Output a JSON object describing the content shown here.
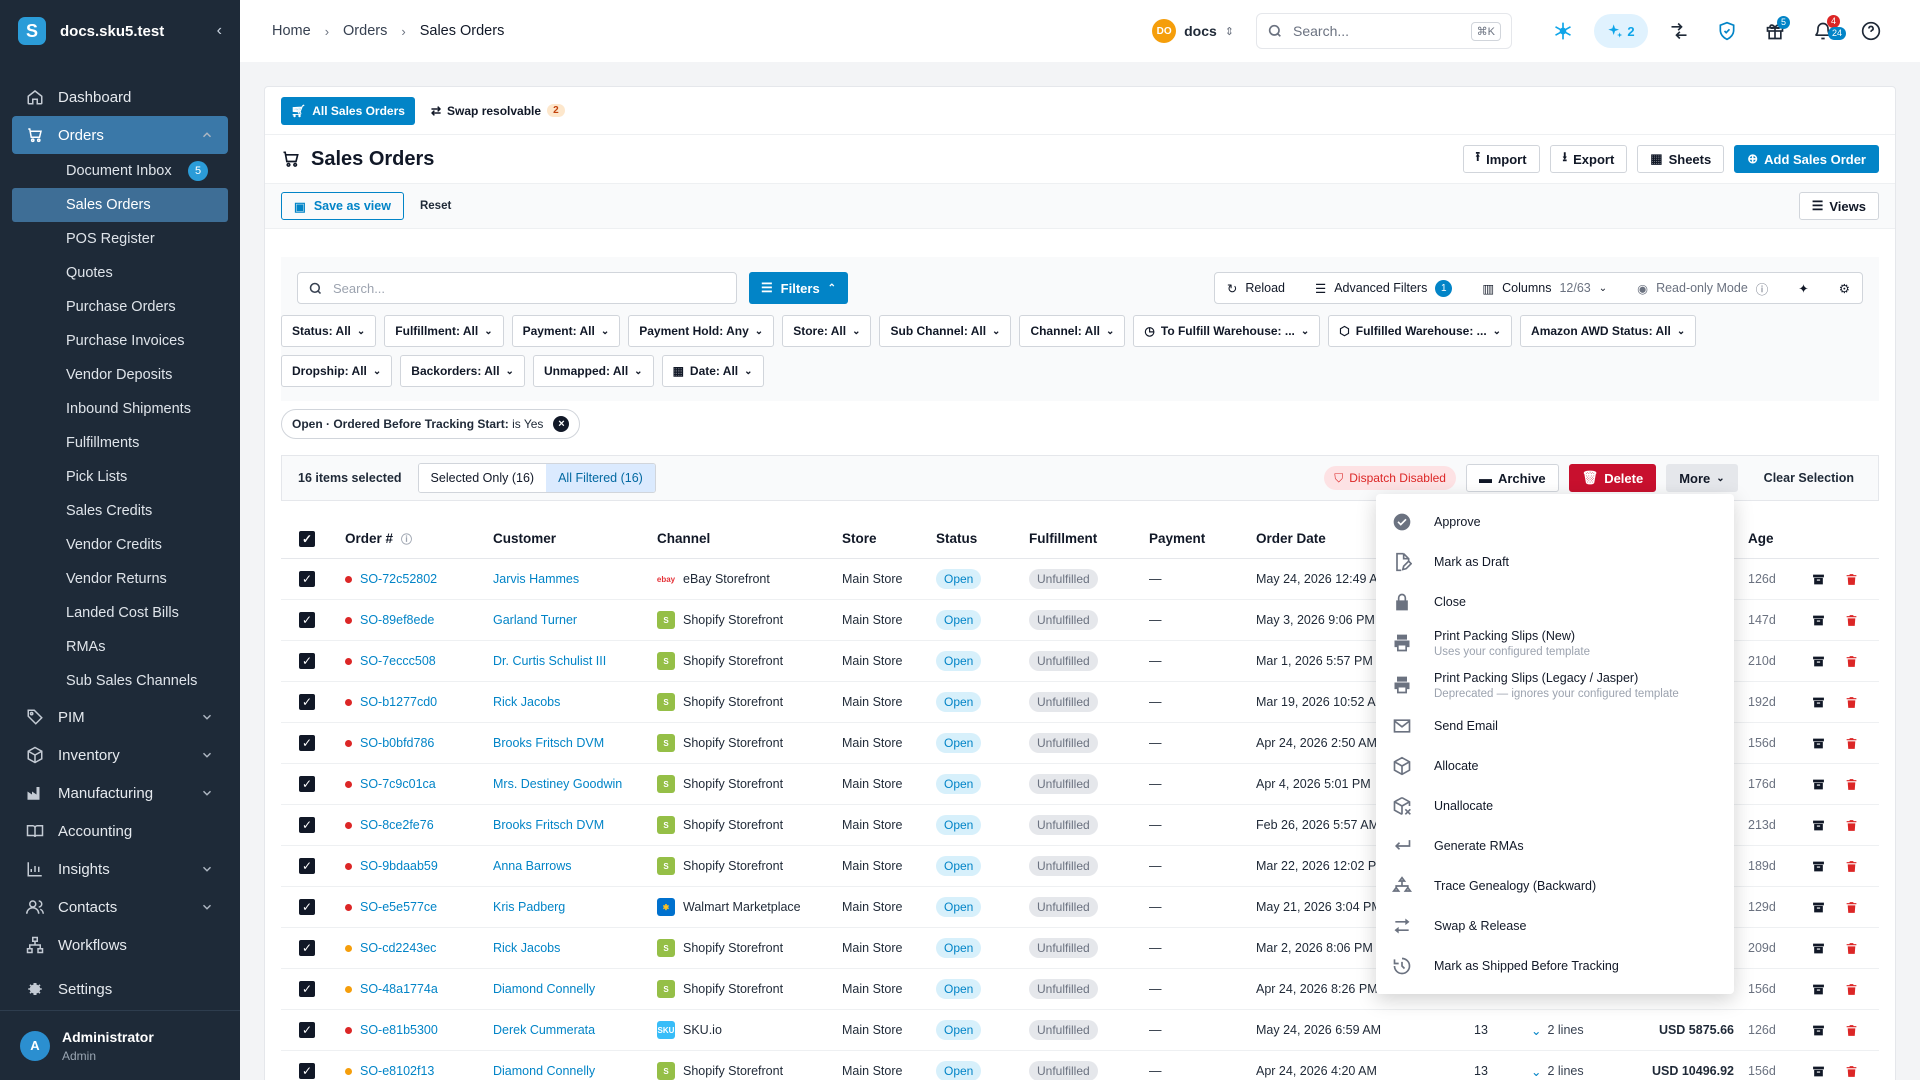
{
  "app": {
    "workspace": "docs.sku5.test",
    "logo_letter": "S"
  },
  "sidebar": {
    "items": [
      {
        "label": "Dashboard",
        "icon": "home-icon"
      },
      {
        "label": "Orders",
        "icon": "cart-icon",
        "active": true
      },
      {
        "label": "PIM",
        "icon": "tag-icon"
      },
      {
        "label": "Inventory",
        "icon": "box-icon"
      },
      {
        "label": "Manufacturing",
        "icon": "factory-icon"
      },
      {
        "label": "Accounting",
        "icon": "book-icon"
      },
      {
        "label": "Insights",
        "icon": "chart-icon"
      },
      {
        "label": "Contacts",
        "icon": "users-icon"
      },
      {
        "label": "Workflows",
        "icon": "workflow-icon"
      },
      {
        "label": "Settings",
        "icon": "gear-icon"
      }
    ],
    "order_sub": [
      "Document Inbox",
      "Sales Orders",
      "POS Register",
      "Quotes",
      "Purchase Orders",
      "Purchase Invoices",
      "Vendor Deposits",
      "Inbound Shipments",
      "Fulfillments",
      "Pick Lists",
      "Sales Credits",
      "Vendor Credits",
      "Vendor Returns",
      "Landed Cost Bills",
      "RMAs",
      "Sub Sales Channels"
    ],
    "inbox_badge": "5",
    "user": {
      "initial": "A",
      "name": "Administrator",
      "role": "Admin"
    }
  },
  "topbar": {
    "crumbs": [
      "Home",
      "Orders",
      "Sales Orders"
    ],
    "workspace_initials": "DO",
    "workspace_name": "docs",
    "search_placeholder": "Search...",
    "search_kbd": "⌘K",
    "ai_count": "2",
    "gift_badge": "5",
    "bell_badge_a": "4",
    "bell_badge_b": "24"
  },
  "tabs": {
    "all": "All Sales Orders",
    "swap": "Swap resolvable",
    "swap_count": "2"
  },
  "header": {
    "title": "Sales Orders",
    "import": "Import",
    "export": "Export",
    "sheets": "Sheets",
    "add": "Add Sales Order"
  },
  "views": {
    "save": "Save as view",
    "reset": "Reset",
    "views": "Views"
  },
  "toolbar": {
    "search_placeholder": "Search...",
    "filters": "Filters",
    "reload": "Reload",
    "advanced": "Advanced Filters",
    "advanced_count": "1",
    "columns": "Columns",
    "columns_count": "12/63",
    "readonly": "Read-only Mode"
  },
  "filter_chips": [
    [
      "Status: All",
      "Fulfillment: All",
      "Payment: All",
      "Payment Hold: Any",
      "Store: All",
      "Sub Channel: All",
      "Channel: All",
      "To Fulfill Warehouse: ...",
      "Fulfilled Warehouse: ...",
      "Amazon AWD Status: All"
    ],
    [
      "Dropship: All",
      "Backorders: All",
      "Unmapped: All",
      "Date: All"
    ]
  ],
  "active_filter": {
    "prefix": "Open · Ordered Before Tracking Start:",
    "value": "is Yes"
  },
  "selection": {
    "count": "16 items selected",
    "selected_only": "Selected Only (16)",
    "all_filtered": "All Filtered (16)",
    "dispatch": "Dispatch Disabled",
    "archive": "Archive",
    "delete": "Delete",
    "more": "More",
    "clear": "Clear Selection"
  },
  "columns": {
    "order": "Order #",
    "customer": "Customer",
    "channel": "Channel",
    "store": "Store",
    "status": "Status",
    "fulfillment": "Fulfillment",
    "payment": "Payment",
    "date": "Order Date",
    "age": "Age"
  },
  "rows": [
    {
      "order": "SO-72c52802",
      "dot": "#dc2626",
      "customer": "Jarvis Hammes",
      "channel": "eBay Storefront",
      "ch": "ebay",
      "store": "Main Store",
      "status": "Open",
      "ful": "Unfulfilled",
      "pay": "—",
      "date": "May 24, 2026 12:49 AM",
      "x1": "",
      "x2": "",
      "amt": "",
      "age": "126d"
    },
    {
      "order": "SO-89ef8ede",
      "dot": "#dc2626",
      "customer": "Garland Turner",
      "channel": "Shopify Storefront",
      "ch": "shopify",
      "store": "Main Store",
      "status": "Open",
      "ful": "Unfulfilled",
      "pay": "—",
      "date": "May 3, 2026 9:06 PM",
      "x1": "",
      "x2": "",
      "amt": "",
      "age": "147d"
    },
    {
      "order": "SO-7eccc508",
      "dot": "#dc2626",
      "customer": "Dr. Curtis Schulist III",
      "channel": "Shopify Storefront",
      "ch": "shopify",
      "store": "Main Store",
      "status": "Open",
      "ful": "Unfulfilled",
      "pay": "—",
      "date": "Mar 1, 2026 5:57 PM",
      "x1": "",
      "x2": "",
      "amt": "",
      "age": "210d"
    },
    {
      "order": "SO-b1277cd0",
      "dot": "#dc2626",
      "customer": "Rick Jacobs",
      "channel": "Shopify Storefront",
      "ch": "shopify",
      "store": "Main Store",
      "status": "Open",
      "ful": "Unfulfilled",
      "pay": "—",
      "date": "Mar 19, 2026 10:52 AM",
      "x1": "",
      "x2": "",
      "amt": "",
      "age": "192d"
    },
    {
      "order": "SO-b0bfd786",
      "dot": "#dc2626",
      "customer": "Brooks Fritsch DVM",
      "channel": "Shopify Storefront",
      "ch": "shopify",
      "store": "Main Store",
      "status": "Open",
      "ful": "Unfulfilled",
      "pay": "—",
      "date": "Apr 24, 2026 2:50 AM",
      "x1": "",
      "x2": "",
      "amt": "",
      "age": "156d"
    },
    {
      "order": "SO-7c9c01ca",
      "dot": "#dc2626",
      "customer": "Mrs. Destiney Goodwin",
      "channel": "Shopify Storefront",
      "ch": "shopify",
      "store": "Main Store",
      "status": "Open",
      "ful": "Unfulfilled",
      "pay": "—",
      "date": "Apr 4, 2026 5:01 PM",
      "x1": "",
      "x2": "",
      "amt": "",
      "age": "176d"
    },
    {
      "order": "SO-8ce2fe76",
      "dot": "#dc2626",
      "customer": "Brooks Fritsch DVM",
      "channel": "Shopify Storefront",
      "ch": "shopify",
      "store": "Main Store",
      "status": "Open",
      "ful": "Unfulfilled",
      "pay": "—",
      "date": "Feb 26, 2026 5:57 AM",
      "x1": "",
      "x2": "",
      "amt": "",
      "age": "213d"
    },
    {
      "order": "SO-9bdaab59",
      "dot": "#dc2626",
      "customer": "Anna Barrows",
      "channel": "Shopify Storefront",
      "ch": "shopify",
      "store": "Main Store",
      "status": "Open",
      "ful": "Unfulfilled",
      "pay": "—",
      "date": "Mar 22, 2026 12:02 PM",
      "x1": "",
      "x2": "",
      "amt": "",
      "age": "189d"
    },
    {
      "order": "SO-e5e577ce",
      "dot": "#dc2626",
      "customer": "Kris Padberg",
      "channel": "Walmart Marketplace",
      "ch": "walmart",
      "store": "Main Store",
      "status": "Open",
      "ful": "Unfulfilled",
      "pay": "—",
      "date": "May 21, 2026 3:04 PM",
      "x1": "",
      "x2": "",
      "amt": "",
      "age": "129d"
    },
    {
      "order": "SO-cd2243ec",
      "dot": "#f59e0b",
      "customer": "Rick Jacobs",
      "channel": "Shopify Storefront",
      "ch": "shopify",
      "store": "Main Store",
      "status": "Open",
      "ful": "Unfulfilled",
      "pay": "—",
      "date": "Mar 2, 2026 8:06 PM",
      "x1": "",
      "x2": "",
      "amt": "",
      "age": "209d"
    },
    {
      "order": "SO-48a1774a",
      "dot": "#f59e0b",
      "customer": "Diamond Connelly",
      "channel": "Shopify Storefront",
      "ch": "shopify",
      "store": "Main Store",
      "status": "Open",
      "ful": "Unfulfilled",
      "pay": "—",
      "date": "Apr 24, 2026 8:26 PM",
      "x1": "",
      "x2": "",
      "amt": "",
      "age": "156d"
    },
    {
      "order": "SO-e81b5300",
      "dot": "#dc2626",
      "customer": "Derek Cummerata",
      "channel": "SKU.io",
      "ch": "skuio",
      "store": "Main Store",
      "status": "Open",
      "ful": "Unfulfilled",
      "pay": "—",
      "date": "May 24, 2026 6:59 AM",
      "x1": "13",
      "x2": "2 lines",
      "amt": "USD 5875.66",
      "age": "126d"
    },
    {
      "order": "SO-e8102f13",
      "dot": "#f59e0b",
      "customer": "Diamond Connelly",
      "channel": "Shopify Storefront",
      "ch": "shopify",
      "store": "Main Store",
      "status": "Open",
      "ful": "Unfulfilled",
      "pay": "—",
      "date": "Apr 24, 2026 4:20 AM",
      "x1": "13",
      "x2": "2 lines",
      "amt": "USD 10496.92",
      "age": "156d"
    }
  ],
  "menu": [
    {
      "label": "Approve",
      "icon": "check-circle-icon"
    },
    {
      "label": "Mark as Draft",
      "icon": "edit-doc-icon"
    },
    {
      "label": "Close",
      "icon": "lock-icon"
    },
    {
      "label": "Print Packing Slips (New)",
      "sub": "Uses your configured template",
      "icon": "printer-icon"
    },
    {
      "label": "Print Packing Slips (Legacy / Jasper)",
      "sub": "Deprecated — ignores your configured template",
      "icon": "printer-icon"
    },
    {
      "label": "Send Email",
      "icon": "mail-icon"
    },
    {
      "label": "Allocate",
      "icon": "box-icon"
    },
    {
      "label": "Unallocate",
      "icon": "box-x-icon"
    },
    {
      "label": "Generate RMAs",
      "icon": "return-icon"
    },
    {
      "label": "Trace Genealogy (Backward)",
      "icon": "tree-icon"
    },
    {
      "label": "Swap & Release",
      "icon": "swap-icon"
    },
    {
      "label": "Mark as Shipped Before Tracking",
      "icon": "clock-icon"
    }
  ]
}
